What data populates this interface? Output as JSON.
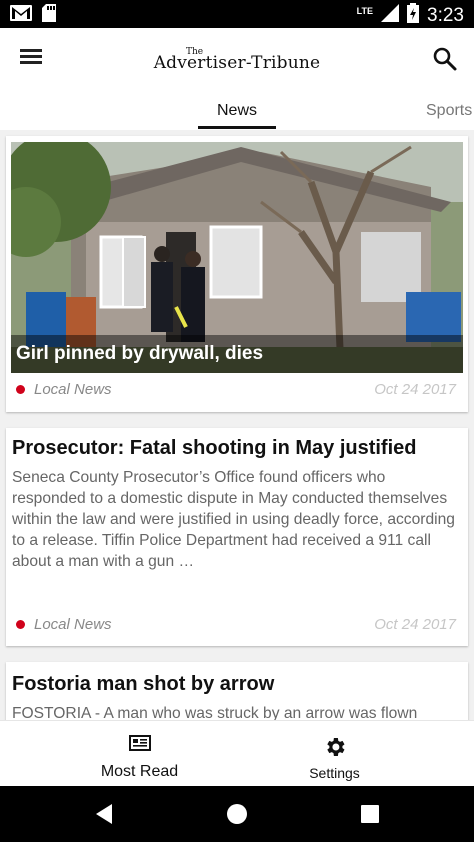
{
  "status_bar": {
    "time": "3:23",
    "network": "LTE",
    "icons": [
      "gmail-icon",
      "sd-card-icon",
      "signal-icon",
      "battery-icon"
    ]
  },
  "app_bar": {
    "logo_small": "The",
    "logo_main": "Advertiser-Tribune",
    "icons": [
      "menu-icon",
      "search-icon"
    ]
  },
  "tabs": [
    {
      "label": "News",
      "selected": true
    },
    {
      "label": "Sports",
      "selected": false
    }
  ],
  "articles": [
    {
      "headline": "Girl pinned by drywall, dies",
      "section": "Local News",
      "date": "Oct 24 2017",
      "has_image": true
    },
    {
      "headline": "Prosecutor: Fatal shooting in May justified",
      "summary": "Seneca County Prosecutor’s Office found officers who responded to a domestic dispute in May conducted themselves within the law and were justified in using deadly force, according to a release. Tiffin Police Department had received a 911 call about a man with a gun …",
      "section": "Local News",
      "date": "Oct 24 2017"
    },
    {
      "headline": "Fostoria man shot by arrow",
      "summary": "FOSTORIA - A man who was struck by an arrow was flown"
    }
  ],
  "bottom_nav": {
    "most_read": "Most Read",
    "settings": "Settings"
  },
  "colors": {
    "section_dot": "#d0021b",
    "tab_indicator": "#111111",
    "status_bar": "#000000"
  }
}
